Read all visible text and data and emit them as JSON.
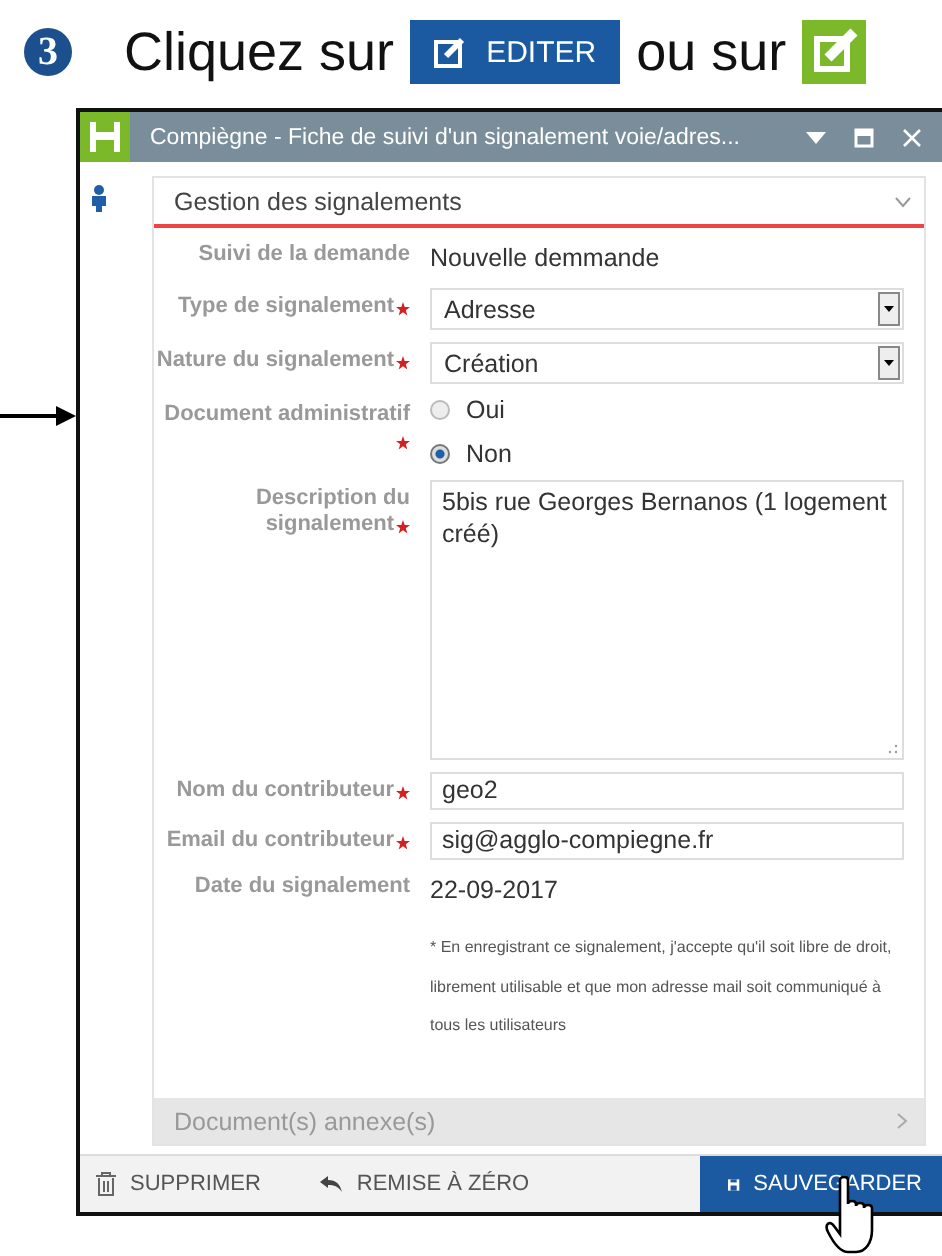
{
  "instruction": {
    "step": "3",
    "text_before": "Cliquez sur",
    "edit_button": "EDITER",
    "text_after": "ou sur"
  },
  "window": {
    "title": "Compiègne - Fiche de suivi d'un signalement voie/adres..."
  },
  "sections": [
    {
      "title": "Gestion des signalements",
      "expanded": true
    },
    {
      "title": "Document(s) annexe(s)",
      "expanded": false
    }
  ],
  "fields": [
    {
      "kind": "static",
      "label": "Suivi de la demande",
      "required": false,
      "value": "Nouvelle demmande"
    },
    {
      "kind": "select",
      "label": "Type de signalement",
      "required": true,
      "value": "Adresse"
    },
    {
      "kind": "select",
      "label": "Nature du signalement",
      "required": true,
      "value": "Création"
    },
    {
      "kind": "radio",
      "label": "Document administratif",
      "required": true,
      "options": [
        {
          "label": "Oui",
          "selected": false
        },
        {
          "label": "Non",
          "selected": true
        }
      ]
    },
    {
      "kind": "textarea",
      "label": "Description du signalement",
      "required": true,
      "value": "5bis rue Georges Bernanos (1 logement créé)"
    },
    {
      "kind": "input",
      "label": "Nom du contributeur",
      "required": true,
      "value": "geo2"
    },
    {
      "kind": "input",
      "label": "Email du contributeur",
      "required": true,
      "value": "sig@agglo-compiegne.fr"
    },
    {
      "kind": "static",
      "label": "Date du signalement",
      "required": false,
      "value": "22-09-2017"
    }
  ],
  "note": "* En enregistrant ce signalement, j'accepte qu'il soit libre de droit, librement utilisable et que mon adresse mail soit communiqué à tous les utilisateurs",
  "footer": {
    "delete": "SUPPRIMER",
    "reset": "REMISE À ZÉRO",
    "save": "SAUVEGARDER"
  }
}
